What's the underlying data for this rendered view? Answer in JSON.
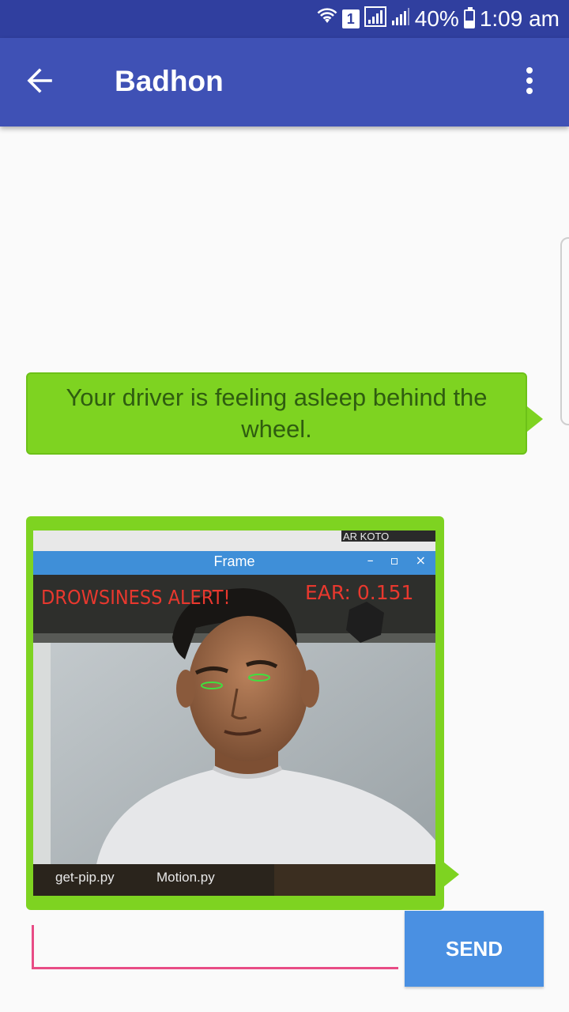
{
  "status_bar": {
    "wifi_icon": "wifi-icon",
    "sim_badge": "1",
    "battery_percent": "40%",
    "battery_level": 0.4,
    "time": "1:09 am"
  },
  "app_bar": {
    "title": "Badhon",
    "back_icon": "arrow-back-icon",
    "menu_icon": "more-vertical-icon"
  },
  "messages": [
    {
      "type": "text",
      "text": "Your driver is feeling asleep behind the wheel."
    },
    {
      "type": "image",
      "window_title": "Frame",
      "alert_text": "DROWSINESS ALERT!",
      "ear_text": "EAR: 0.151",
      "corner_text": "AR KOTO",
      "taskbar_items": [
        "get-pip.py",
        "Motion.py"
      ]
    }
  ],
  "composer": {
    "input_value": "",
    "send_label": "SEND"
  },
  "colors": {
    "status_bar": "#303f9f",
    "app_bar": "#3f51b5",
    "bubble": "#7ed321",
    "send_button": "#4a90e2",
    "input_accent": "#e84c85",
    "alert_red": "#e8382e"
  }
}
